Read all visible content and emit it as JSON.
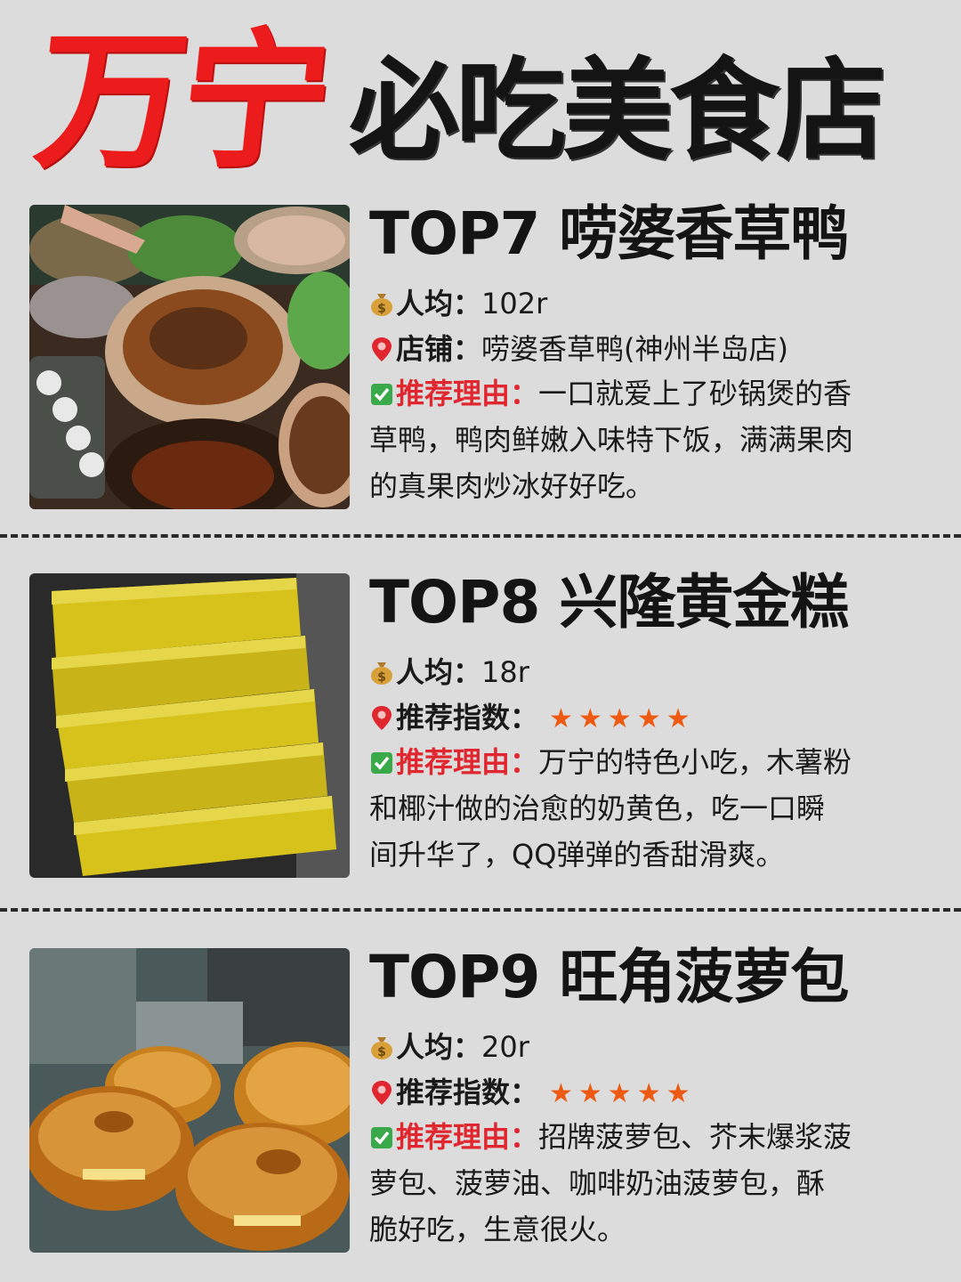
{
  "title": {
    "red": "万宁",
    "black": "必吃美食店"
  },
  "entries": [
    {
      "heading": "TOP7 唠婆香草鸭",
      "price_label": "人均：",
      "price": "102r",
      "second_label": "店铺：",
      "second_value": "唠婆香草鸭(神州半岛店)",
      "reason_label": "推荐理由：",
      "reason_lines": [
        "一口就爱上了砂锅煲的香",
        "草鸭，鸭肉鲜嫩入味特下饭，满满果肉",
        "的真果肉炒冰好好吃。"
      ]
    },
    {
      "heading": "TOP8 兴隆黄金糕",
      "price_label": "人均：",
      "price": "18r",
      "second_label": "推荐指数：",
      "stars": "★★★★★",
      "reason_label": "推荐理由：",
      "reason_lines": [
        "万宁的特色小吃，木薯粉",
        "和椰汁做的治愈的奶黄色，吃一口瞬",
        "间升华了，QQ弹弹的香甜滑爽。"
      ]
    },
    {
      "heading": "TOP9 旺角菠萝包",
      "price_label": "人均：",
      "price": "20r",
      "second_label": "推荐指数：",
      "stars": "★★★★★",
      "reason_label": "推荐理由：",
      "reason_lines": [
        "招牌菠萝包、芥末爆浆菠",
        "萝包、菠萝油、咖啡奶油菠萝包，酥",
        "脆好吃，生意很火。"
      ]
    }
  ],
  "icons": [
    "money-bag-icon",
    "location-pin-icon",
    "check-box-icon"
  ],
  "colors": {
    "red": "#ec1c1c",
    "stars": "#ef5a12",
    "background": "#dcdcdc"
  }
}
